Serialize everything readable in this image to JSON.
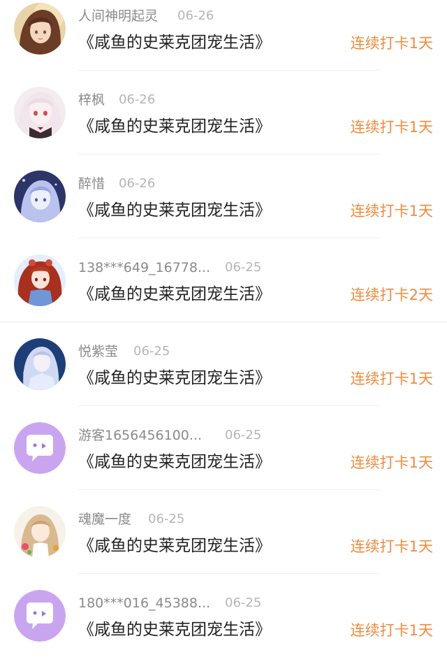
{
  "colors": {
    "streak": "#f08b3e",
    "username": "#8a8a8a",
    "date": "#b5b5b5",
    "title": "#222222",
    "default_avatar": "#c9a5f0"
  },
  "checkins": [
    {
      "username": "人间神明起灵",
      "date": "06-26",
      "book": "《咸鱼的史莱克团宠生活》",
      "streak": "连续打卡1天",
      "avatar": "girl-avatar-brown-hair"
    },
    {
      "username": "梓枫",
      "date": "06-26",
      "book": "《咸鱼的史莱克团宠生活》",
      "streak": "连续打卡1天",
      "avatar": "girl-avatar-white-hair"
    },
    {
      "username": "醉惜",
      "date": "06-26",
      "book": "《咸鱼的史莱克团宠生活》",
      "streak": "连续打卡1天",
      "avatar": "girl-avatar-blue-night"
    },
    {
      "username": "138***649_16778...",
      "date": "06-25",
      "book": "《咸鱼的史莱克团宠生活》",
      "streak": "连续打卡2天",
      "avatar": "girl-avatar-red-hair"
    },
    {
      "username": "悦紫莹",
      "date": "06-25",
      "book": "《咸鱼的史莱克团宠生活》",
      "streak": "连续打卡1天",
      "avatar": "girl-avatar-blue-dress"
    },
    {
      "username": "游客1656456100...",
      "date": "06-25",
      "book": "《咸鱼的史莱克团宠生活》",
      "streak": "连续打卡1天",
      "avatar": "default-chat-avatar"
    },
    {
      "username": "魂魔一度",
      "date": "06-25",
      "book": "《咸鱼的史莱克团宠生活》",
      "streak": "连续打卡1天",
      "avatar": "girl-avatar-flowers"
    },
    {
      "username": "180***016_45388...",
      "date": "06-25",
      "book": "《咸鱼的史莱克团宠生活》",
      "streak": "连续打卡1天",
      "avatar": "default-chat-avatar"
    }
  ]
}
